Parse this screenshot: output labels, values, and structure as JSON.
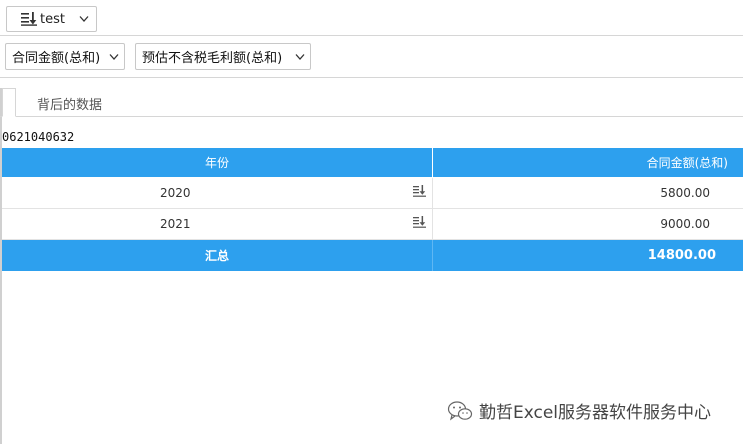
{
  "toolbar": {
    "view_label": "test",
    "view_icon": "sort-desc-icon"
  },
  "measures": {
    "measure1": "合同金额(总和)",
    "measure2": "预估不含税毛利额(总和)"
  },
  "tabs": {
    "data_tab": "背后的数据"
  },
  "data_id": "0621040632",
  "table": {
    "headers": [
      "年份",
      "合同金额(总和)"
    ],
    "rows": [
      {
        "year": "2020",
        "amount": "5800.00"
      },
      {
        "year": "2021",
        "amount": "9000.00"
      }
    ],
    "total": {
      "label": "汇总",
      "amount": "14800.00"
    }
  },
  "watermark": {
    "text": "勤哲Excel服务器软件服务中心",
    "icon": "wechat-icon"
  },
  "colors": {
    "header_blue": "#2da0ee",
    "border": "#d6d6d6"
  }
}
